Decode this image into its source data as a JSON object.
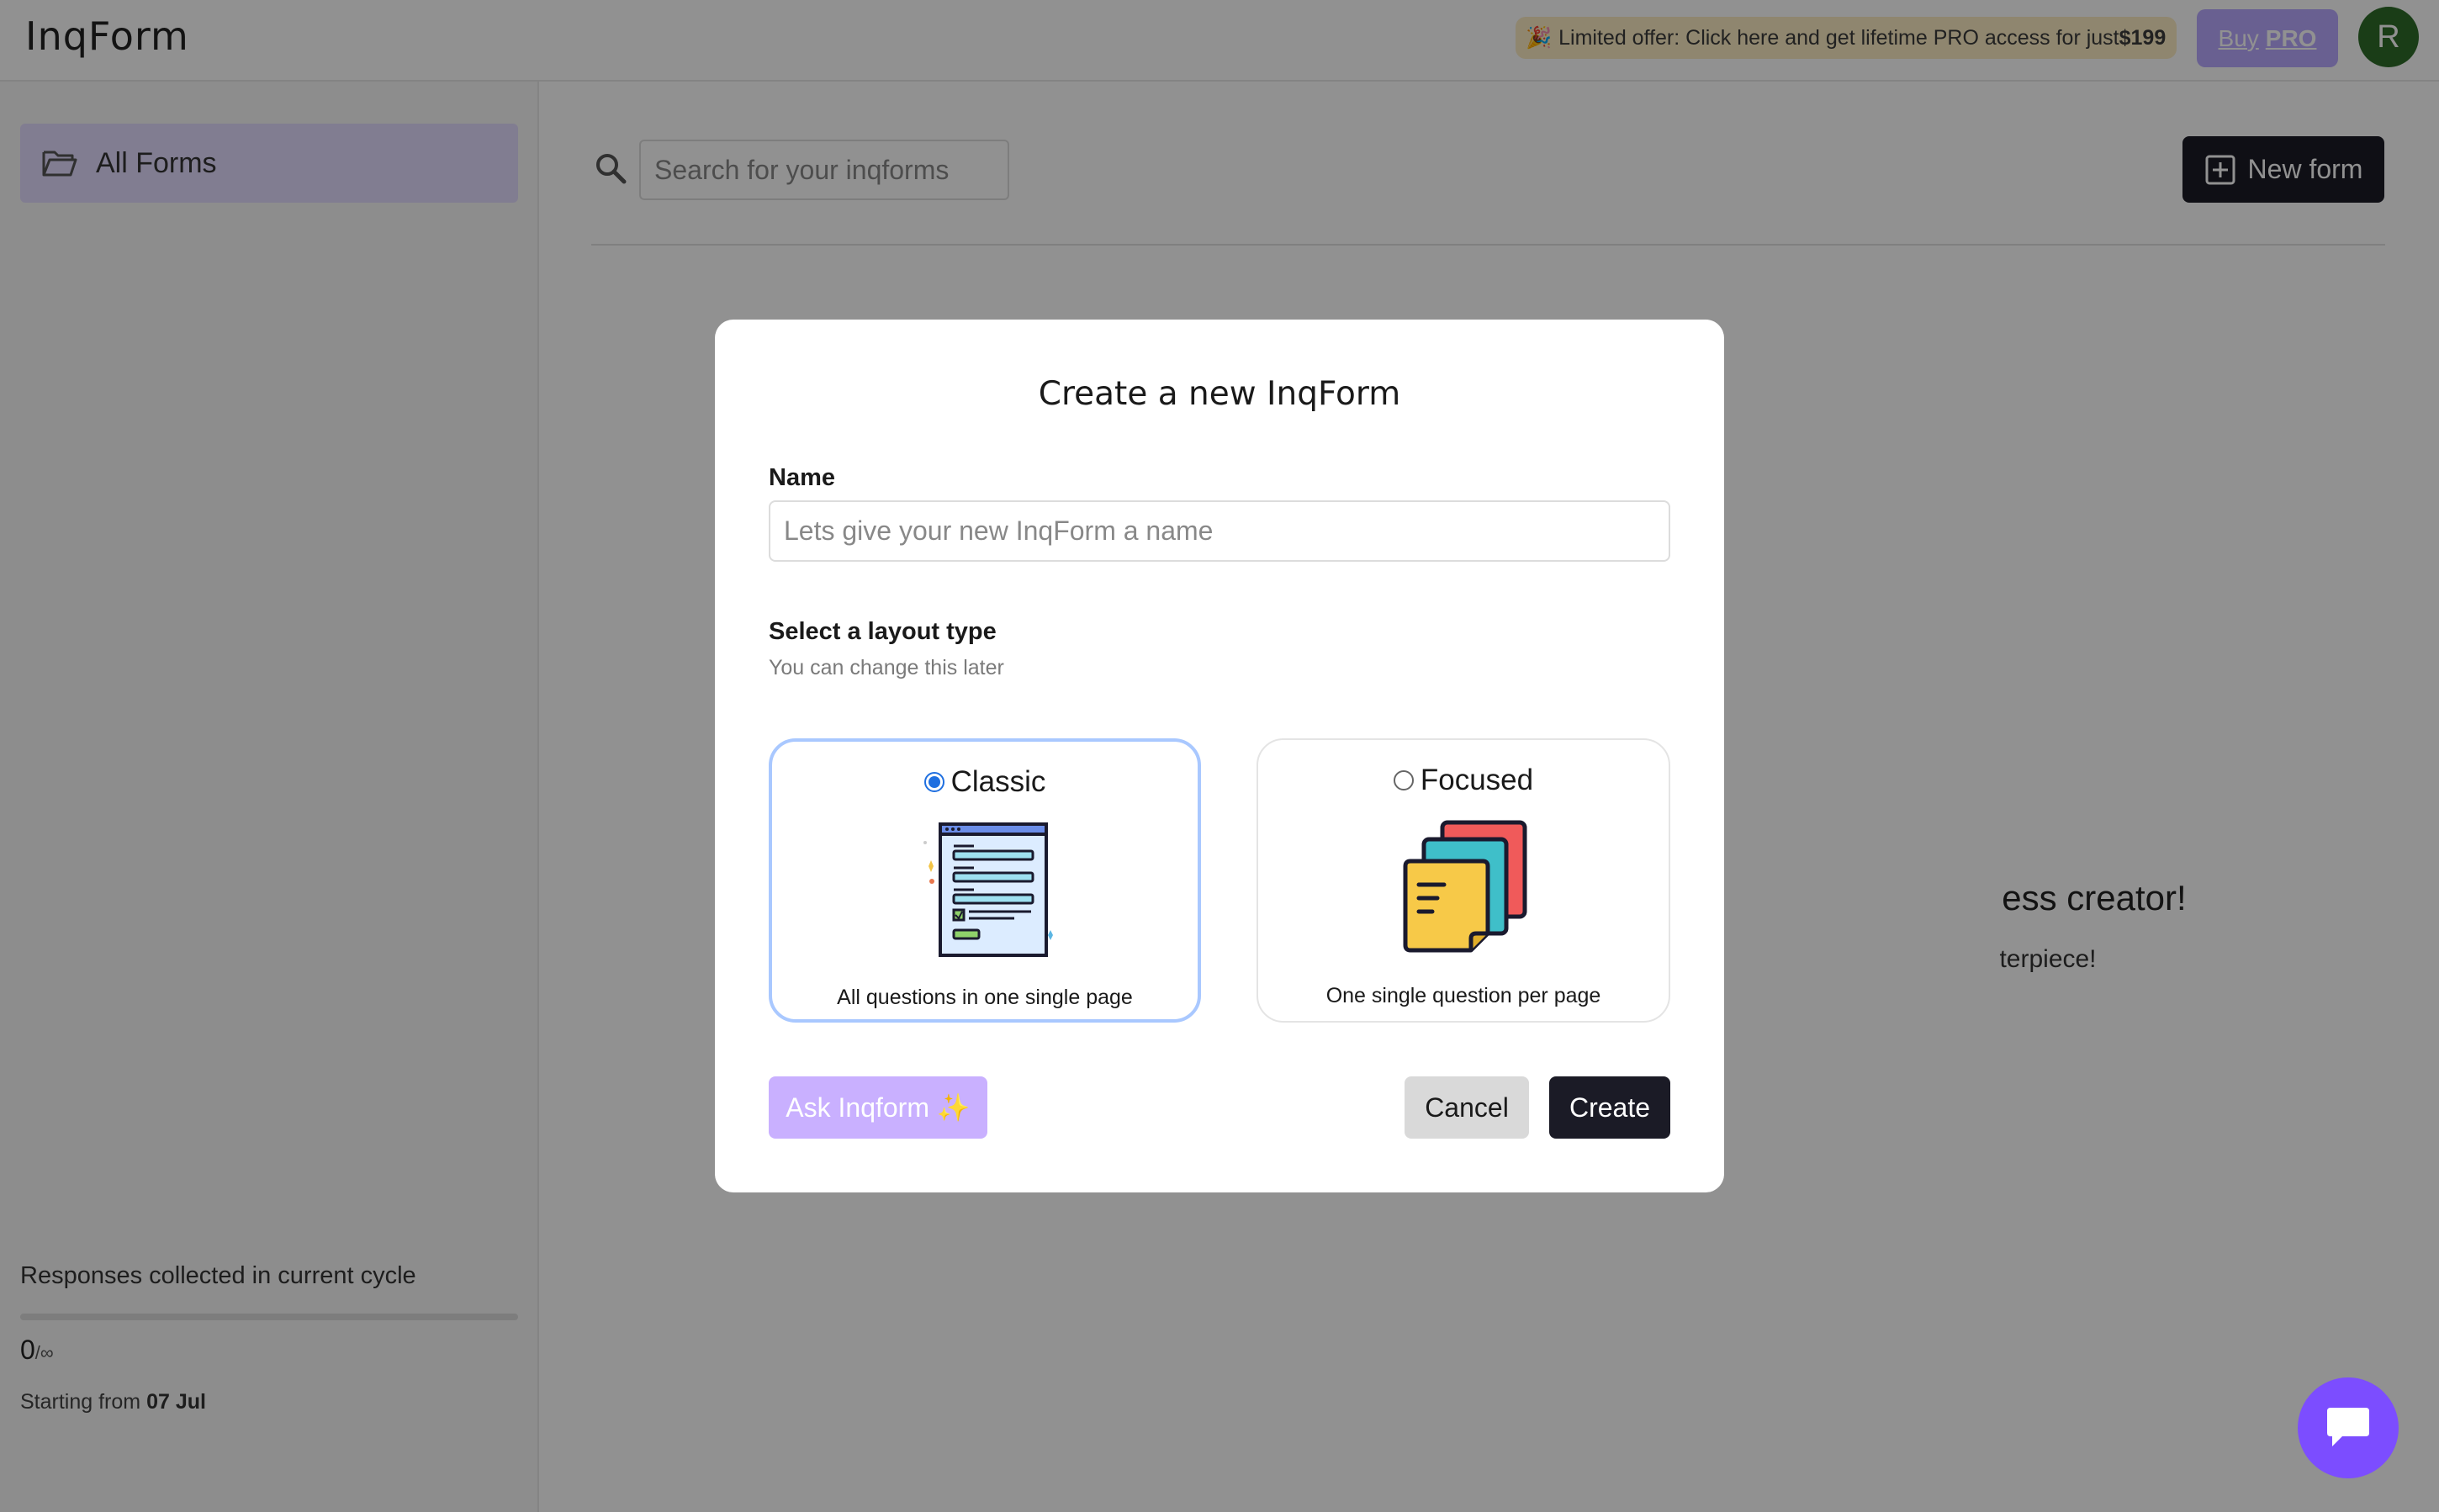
{
  "header": {
    "logo": "InqForm",
    "promo": {
      "emoji": "🎉",
      "text": "Limited offer: Click here and get lifetime PRO access for just ",
      "price": "$199"
    },
    "buy_pro": {
      "prefix": "Buy",
      "emphasis": "PRO"
    },
    "avatar_initial": "R"
  },
  "sidebar": {
    "items": [
      {
        "label": "All Forms",
        "icon": "folder-icon",
        "active": true
      }
    ],
    "usage": {
      "title": "Responses collected in current cycle",
      "count": "0",
      "limit": "/∞",
      "progress": 0,
      "start_prefix": "Starting from ",
      "start_date": "07 Jul"
    }
  },
  "main": {
    "search": {
      "placeholder": "Search for your inqforms"
    },
    "new_form_label": "New form",
    "empty_title": "ess creator!",
    "empty_sub": "terpiece!"
  },
  "modal": {
    "title": "Create a new InqForm",
    "name_label": "Name",
    "name_placeholder": "Lets give your new InqForm a name",
    "name_value": "",
    "layout_label": "Select a layout type",
    "layout_hint": "You can change this later",
    "options": [
      {
        "label": "Classic",
        "caption": "All questions in one single page",
        "selected": true
      },
      {
        "label": "Focused",
        "caption": "One single question per page",
        "selected": false
      }
    ],
    "ask_label": "Ask Inqform ✨",
    "cancel_label": "Cancel",
    "create_label": "Create"
  },
  "colors": {
    "accent": "#7c4dff",
    "dark_button": "#1b1b26",
    "promo_bg": "#fbecc4",
    "selected_border": "#a9c8ff"
  }
}
